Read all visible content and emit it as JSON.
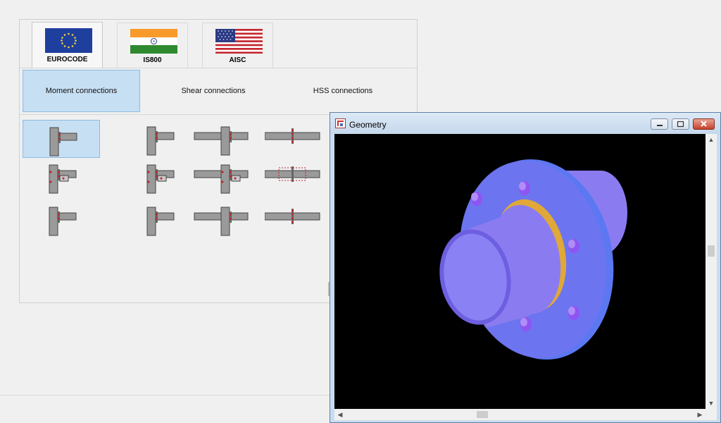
{
  "code_tabs": [
    {
      "label": "EUROCODE",
      "flag_icon": "eu-flag-icon",
      "active": true
    },
    {
      "label": "IS800",
      "flag_icon": "india-flag-icon",
      "active": false
    },
    {
      "label": "AISC",
      "flag_icon": "usa-flag-icon",
      "active": false
    }
  ],
  "connection_tabs": [
    {
      "label": "Moment connections",
      "active": true
    },
    {
      "label": "Shear connections",
      "active": false
    },
    {
      "label": "HSS connections",
      "active": false
    }
  ],
  "connection_icons": [
    "column-beam-endplate-icon",
    "column-beam-cleat-icon",
    "double-beam-column-icon",
    "beam-splice-endplate-icon",
    "column-beam-stiffened-icon",
    "column-beam-plate-icon",
    "double-beam-stiffened-icon",
    "beam-splice-flange-icon",
    "column-beam-flush-icon",
    "column-beam-simple-icon",
    "double-beam-flush-icon",
    "beam-splice-extended-icon"
  ],
  "geometry_window": {
    "title": "Geometry",
    "app_icon": "app-logo-icon",
    "viewport_content": "flanged-pipe-3d-model"
  },
  "colors": {
    "selected_bg": "#c7dff3",
    "model_blue": "#7d7df5",
    "weld_ring": "#e0a838",
    "viewport_bg": "#000000"
  }
}
